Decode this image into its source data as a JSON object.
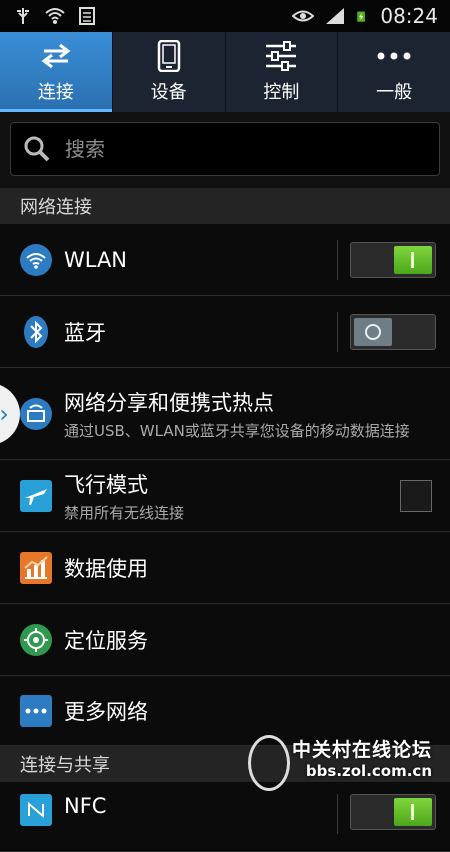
{
  "status_bar": {
    "time": "08:24",
    "icons": [
      "usb-icon",
      "wifi-icon",
      "sim-icon",
      "eye-icon",
      "signal-icon",
      "battery-charging-icon"
    ]
  },
  "tabs": [
    {
      "label": "连接",
      "icon": "arrows-icon",
      "active": true
    },
    {
      "label": "设备",
      "icon": "phone-icon",
      "active": false
    },
    {
      "label": "控制",
      "icon": "sliders-icon",
      "active": false
    },
    {
      "label": "一般",
      "icon": "more-dots-icon",
      "active": false
    }
  ],
  "search": {
    "placeholder": "搜索"
  },
  "sections": {
    "network": "网络连接",
    "sharing": "连接与共享"
  },
  "items": {
    "wlan": {
      "title": "WLAN",
      "toggle": "on"
    },
    "bluetooth": {
      "title": "蓝牙",
      "toggle": "off"
    },
    "hotspot": {
      "title": "网络分享和便携式热点",
      "desc": "通过USB、WLAN或蓝牙共享您设备的移动数据连接"
    },
    "airplane": {
      "title": "飞行模式",
      "desc": "禁用所有无线连接",
      "checked": false
    },
    "data_usage": {
      "title": "数据使用"
    },
    "location": {
      "title": "定位服务"
    },
    "more_networks": {
      "title": "更多网络"
    },
    "nfc": {
      "title": "NFC",
      "toggle": "on"
    }
  },
  "watermark": {
    "text": "中关村在线论坛",
    "url": "bbs.zol.com.cn"
  },
  "colors": {
    "accent": "#2a6fb0",
    "toggle_on": "#6cc531",
    "background": "#0b0b0b"
  }
}
